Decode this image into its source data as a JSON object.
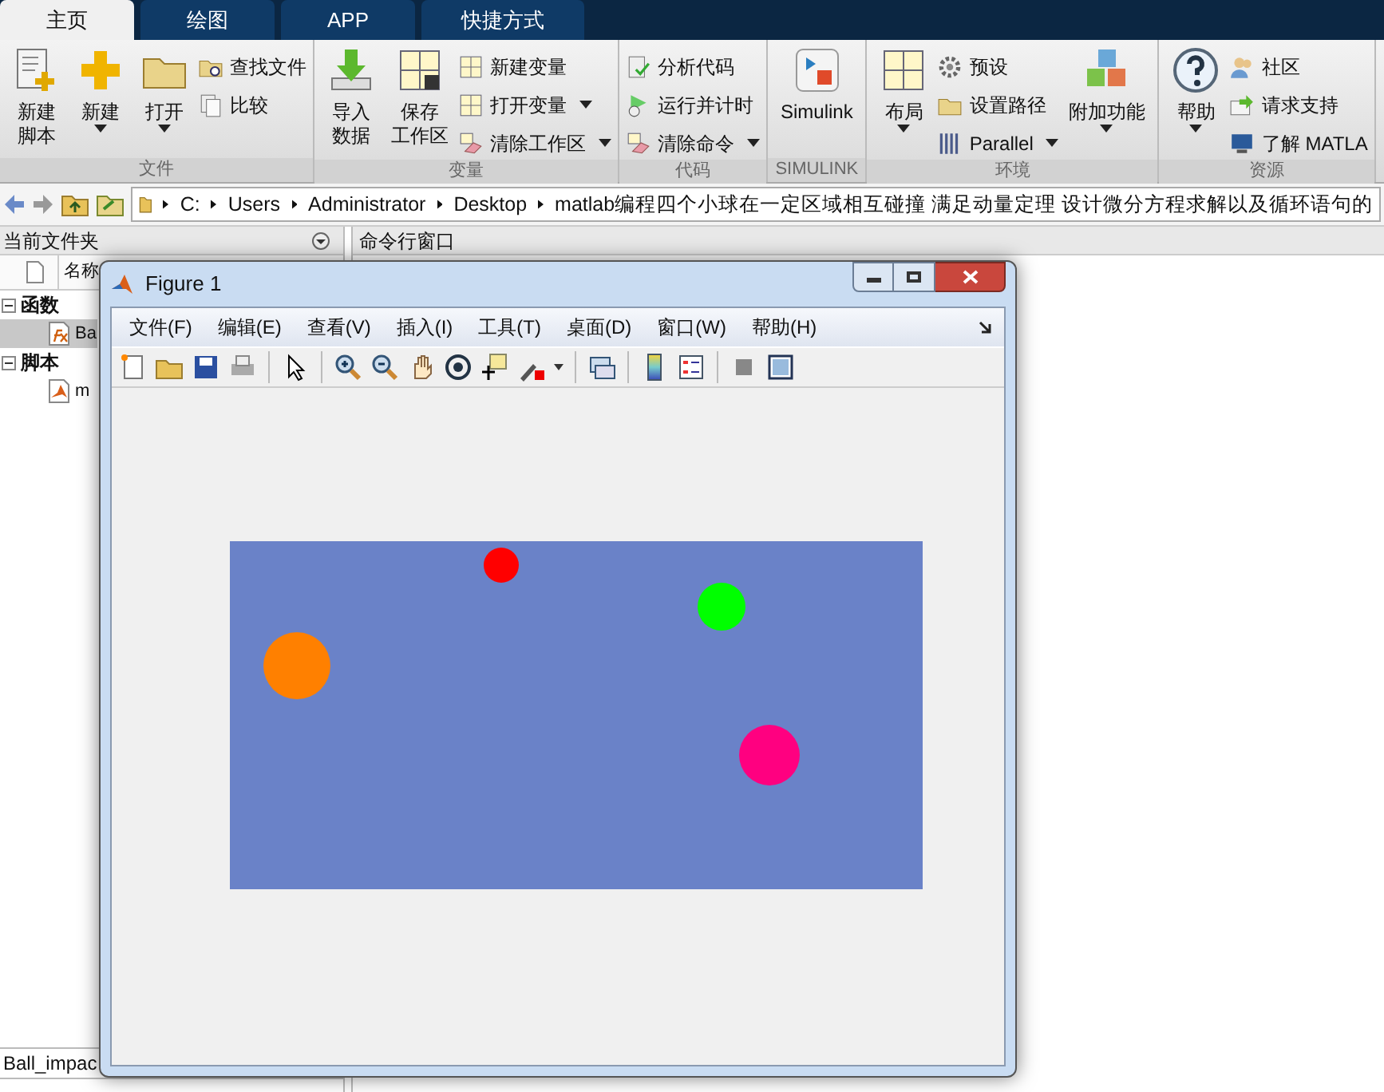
{
  "tabs": [
    {
      "label": "主页",
      "selected": true
    },
    {
      "label": "绘图",
      "selected": false
    },
    {
      "label": "APP",
      "selected": false
    },
    {
      "label": "快捷方式",
      "selected": false
    }
  ],
  "ribbon": [
    {
      "label": "文件",
      "items": [
        {
          "kind": "big",
          "label": [
            "新建",
            "脚本"
          ],
          "dropdown": false
        },
        {
          "kind": "big",
          "label": [
            "新建"
          ],
          "dropdown": true
        },
        {
          "kind": "big",
          "label": [
            "打开"
          ],
          "dropdown": true
        },
        {
          "kind": "small",
          "entries": [
            {
              "label": "查找文件",
              "dropdown": false
            },
            {
              "label": "比较",
              "dropdown": false
            }
          ]
        }
      ]
    },
    {
      "label": "变量",
      "items": [
        {
          "kind": "big",
          "label": [
            "导入",
            "数据"
          ],
          "dropdown": false
        },
        {
          "kind": "big",
          "label": [
            "保存",
            "工作区"
          ],
          "dropdown": false
        },
        {
          "kind": "small",
          "entries": [
            {
              "label": "新建变量",
              "dropdown": false
            },
            {
              "label": "打开变量",
              "dropdown": true
            },
            {
              "label": "清除工作区",
              "dropdown": true
            }
          ]
        }
      ]
    },
    {
      "label": "代码",
      "items": [
        {
          "kind": "small",
          "entries": [
            {
              "label": "分析代码",
              "dropdown": false
            },
            {
              "label": "运行并计时",
              "dropdown": false
            },
            {
              "label": "清除命令",
              "dropdown": true
            }
          ]
        }
      ]
    },
    {
      "label": "SIMULINK",
      "items": [
        {
          "kind": "big",
          "label": [
            "Simulink"
          ],
          "dropdown": false
        }
      ]
    },
    {
      "label": "环境",
      "items": [
        {
          "kind": "big",
          "label": [
            "布局"
          ],
          "dropdown": true
        },
        {
          "kind": "small",
          "entries": [
            {
              "label": "预设",
              "dropdown": false
            },
            {
              "label": "设置路径",
              "dropdown": false
            },
            {
              "label": "Parallel",
              "dropdown": true
            }
          ]
        },
        {
          "kind": "big",
          "label": [
            "附加功能"
          ],
          "dropdown": true
        }
      ]
    },
    {
      "label": "资源",
      "items": [
        {
          "kind": "big",
          "label": [
            "帮助"
          ],
          "dropdown": true
        },
        {
          "kind": "small",
          "entries": [
            {
              "label": "社区",
              "dropdown": false
            },
            {
              "label": "请求支持",
              "dropdown": false
            },
            {
              "label": "了解 MATLA",
              "dropdown": false
            }
          ]
        }
      ]
    }
  ],
  "address": [
    "C:",
    "Users",
    "Administrator",
    "Desktop",
    "matlab编程四个小球在一定区域相互碰撞 满足动量定理 设计微分方程求解以及循环语句的"
  ],
  "file_panel": {
    "title": "当前文件夹",
    "column": "名称",
    "tree": [
      {
        "label": "函数",
        "expanded": true,
        "children": [
          {
            "label": "Ba",
            "selected": true
          }
        ]
      },
      {
        "label": "脚本",
        "expanded": true,
        "children": [
          {
            "label": "m",
            "selected": false
          }
        ]
      }
    ],
    "details": "Ball_impac"
  },
  "command_window": {
    "title": "命令行窗口"
  },
  "figure": {
    "title": "Figure 1",
    "menu": [
      "文件(F)",
      "编辑(E)",
      "查看(V)",
      "插入(I)",
      "工具(T)",
      "桌面(D)",
      "窗口(W)",
      "帮助(H)"
    ],
    "balls": [
      {
        "color": "#ff0000"
      },
      {
        "color": "#00ff00"
      },
      {
        "color": "#ff8000"
      },
      {
        "color": "#ff0080"
      }
    ]
  }
}
